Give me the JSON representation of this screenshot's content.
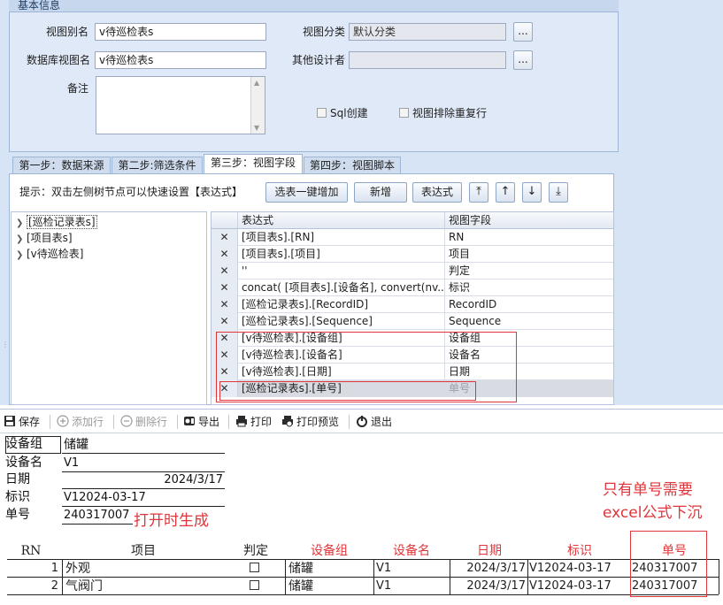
{
  "basic": {
    "section_title": "基本信息",
    "alias_label": "视图别名",
    "alias_value": "v待巡检表s",
    "db_view_label": "数据库视图名",
    "db_view_value": "v待巡检表s",
    "category_label": "视图分类",
    "category_value": "默认分类",
    "other_designer_label": "其他设计者",
    "other_designer_value": "",
    "remark_label": "备注",
    "dots_label": "...",
    "sql_create_label": "Sql创建",
    "exclude_dup_label": "视图排除重复行"
  },
  "tabs": [
    {
      "label": "第一步：数据来源"
    },
    {
      "label": "第二步:筛选条件"
    },
    {
      "label": "第三步：视图字段"
    },
    {
      "label": "第四步：视图脚本"
    }
  ],
  "fields_tab": {
    "tip": "提示：双击左侧树节点可以快速设置【表达式】",
    "buttons": {
      "add_all": "选表一键增加",
      "add": "新增",
      "expression": "表达式"
    },
    "arrow_icons": [
      "move-top-icon",
      "move-up-icon",
      "move-down-icon",
      "move-bottom-icon"
    ],
    "tree": [
      {
        "label": "[巡检记录表s]"
      },
      {
        "label": "[项目表s]"
      },
      {
        "label": "[v待巡检表]"
      }
    ],
    "grid_headers": {
      "expression": "表达式",
      "view_field": "视图字段"
    },
    "rows": [
      {
        "expr": "[项目表s].[RN]",
        "field": "RN"
      },
      {
        "expr": "[项目表s].[项目]",
        "field": "项目"
      },
      {
        "expr": "''",
        "field": "判定"
      },
      {
        "expr": "concat( [项目表s].[设备名], convert(nv...",
        "field": "标识"
      },
      {
        "expr": "[巡检记录表s].[RecordID]",
        "field": "RecordID"
      },
      {
        "expr": "[巡检记录表s].[Sequence]",
        "field": "Sequence"
      },
      {
        "expr": "[v待巡检表].[设备组]",
        "field": "设备组"
      },
      {
        "expr": "[v待巡检表].[设备名]",
        "field": "设备名"
      },
      {
        "expr": "[v待巡检表].[日期]",
        "field": "日期"
      },
      {
        "expr": "[巡检记录表s].[单号]",
        "field": "单号"
      }
    ],
    "delete_glyph": "✕"
  },
  "toolbar": {
    "save": "保存",
    "add_row": "添加行",
    "delete_row": "删除行",
    "export": "导出",
    "print": "打印",
    "print_preview": "打印预览",
    "exit": "退出"
  },
  "report": {
    "header_fields": [
      {
        "label": "设备组",
        "value": "储罐"
      },
      {
        "label": "设备名",
        "value": "V1"
      },
      {
        "label": "日期",
        "value": "2024/3/17"
      },
      {
        "label": "标识",
        "value": "V12024-03-17"
      },
      {
        "label": "单号",
        "value": "240317007"
      }
    ],
    "note_generate": "打开时生成",
    "note_excel_line1": "只有单号需要",
    "note_excel_line2": "excel公式下沉",
    "columns": [
      "RN",
      "项目",
      "判定",
      "设备组",
      "设备名",
      "日期",
      "标识",
      "单号"
    ],
    "rows": [
      {
        "rn": "1",
        "item": "外观",
        "equip_group": "储罐",
        "equip_name": "V1",
        "date": "2024/3/17",
        "ident": "V12024-03-17",
        "order_no": "240317007"
      },
      {
        "rn": "2",
        "item": "气阀门",
        "equip_group": "储罐",
        "equip_name": "V1",
        "date": "2024/3/17",
        "ident": "V12024-03-17",
        "order_no": "240317007"
      }
    ]
  },
  "colors": {
    "accent_red": "#e0353a",
    "panel_blue": "#d6e4f5"
  }
}
